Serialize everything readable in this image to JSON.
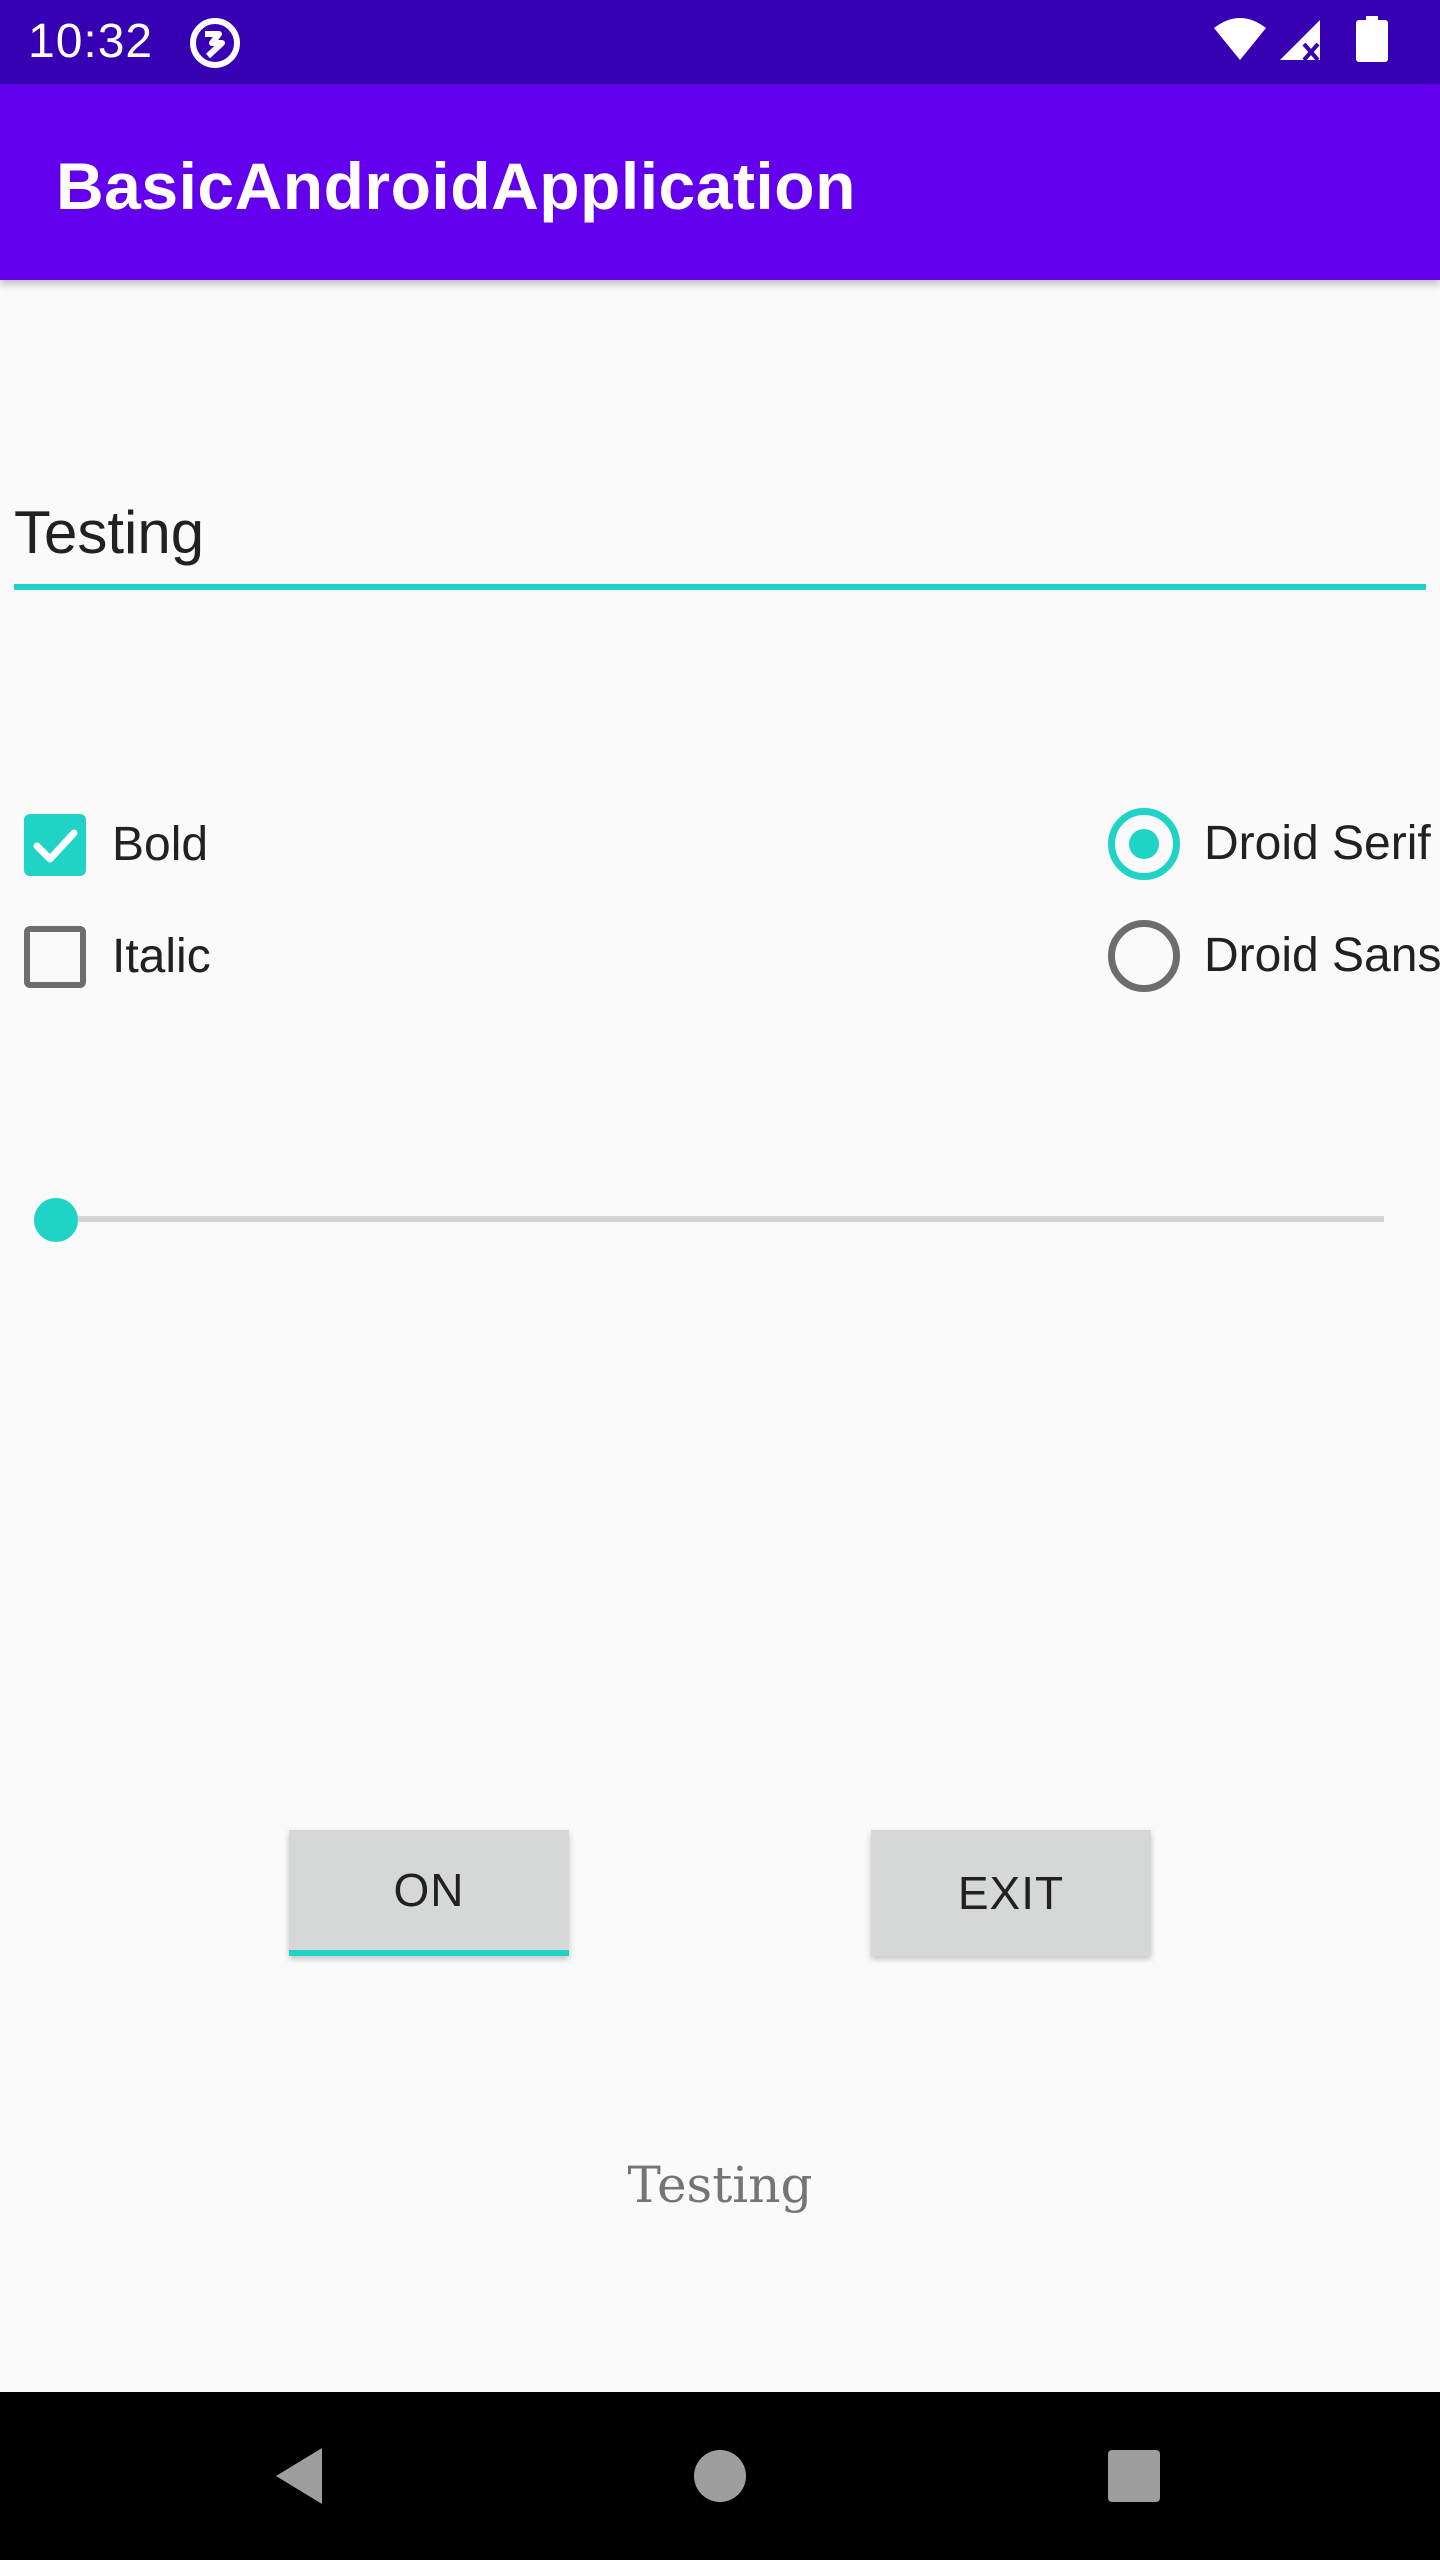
{
  "status_bar": {
    "time": "10:32",
    "icons": [
      "app-notification-icon",
      "wifi-icon",
      "cell-signal-icon",
      "battery-icon"
    ]
  },
  "app_bar": {
    "title": "BasicAndroidApplication",
    "color": "#6200ee",
    "status_color": "#3700b3"
  },
  "text_input": {
    "value": "Testing",
    "accent": "#1fd3c6"
  },
  "checkboxes": [
    {
      "label": "Bold",
      "checked": true
    },
    {
      "label": "Italic",
      "checked": false
    }
  ],
  "radios": [
    {
      "label": "Droid Serif",
      "selected": true
    },
    {
      "label": "Droid Sans",
      "selected": false
    }
  ],
  "seek_bar": {
    "progress": 0
  },
  "buttons": {
    "on_label": "ON",
    "exit_label": "EXIT"
  },
  "output": {
    "text": "Testing"
  },
  "nav": {
    "icons": [
      "back-icon",
      "home-icon",
      "recents-icon"
    ]
  }
}
